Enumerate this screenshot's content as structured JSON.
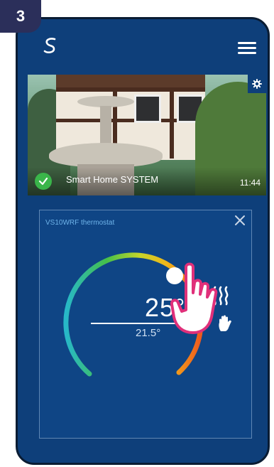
{
  "step": {
    "number": "3"
  },
  "app": {
    "logo_icon": "s-logo-icon",
    "menu_icon": "hamburger-menu-icon"
  },
  "camera": {
    "name": "Smart Home SYSTEM",
    "time": "11:44",
    "status_icon": "check-circle-icon",
    "status_color": "#3ab54a",
    "settings_icon": "gear-icon"
  },
  "thermostat": {
    "title": "VS10WRF thermostat",
    "set_temperature": "25°",
    "current_temperature": "21.5°",
    "mode_icon": "heating-icon",
    "manual_icon": "hand-manual-icon",
    "close_icon": "close-icon"
  },
  "colors": {
    "background": "#0e3f7a",
    "card": "#0f4585",
    "accent_title": "#6fb4ea"
  }
}
